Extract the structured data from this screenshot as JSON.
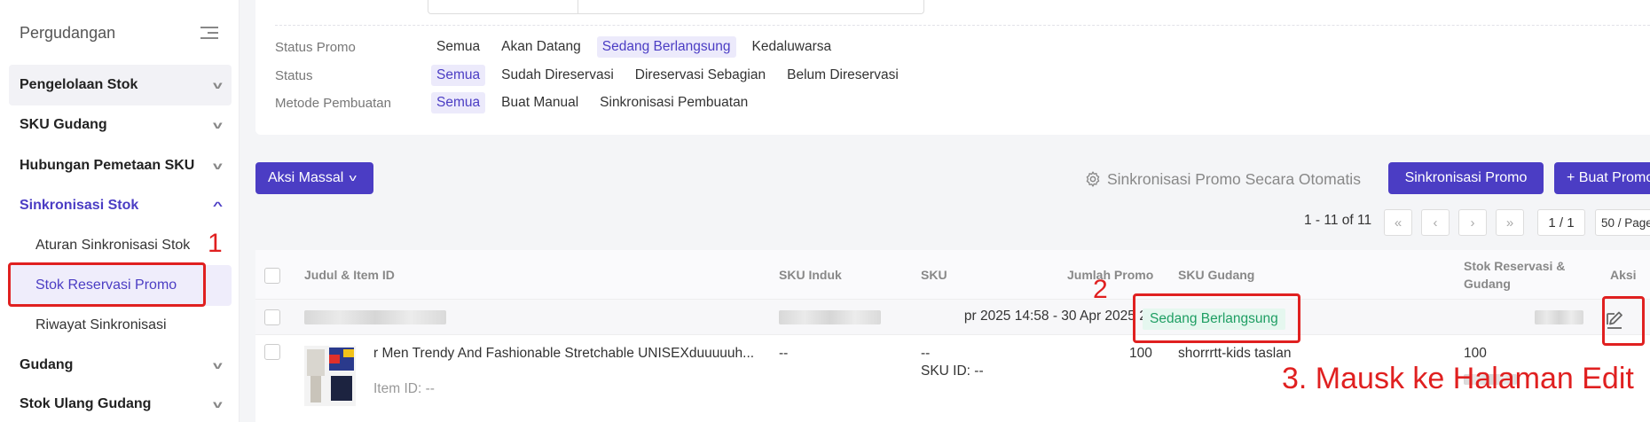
{
  "sidebar": {
    "title": "Pergudangan",
    "items": [
      {
        "label": "Pengelolaan Stok"
      },
      {
        "label": "SKU Gudang"
      },
      {
        "label": "Hubungan Pemetaan SKU"
      },
      {
        "label": "Sinkronisasi Stok"
      },
      {
        "label": "Gudang"
      },
      {
        "label": "Stok Ulang Gudang"
      }
    ],
    "subitems": [
      {
        "label": "Aturan Sinkronisasi Stok"
      },
      {
        "label": "Stok Reservasi Promo"
      },
      {
        "label": "Riwayat Sinkronisasi"
      }
    ]
  },
  "filters": {
    "promo_status": {
      "label": "Status Promo",
      "options": [
        "Semua",
        "Akan Datang",
        "Sedang Berlangsung",
        "Kedaluwarsa"
      ]
    },
    "status": {
      "label": "Status",
      "options": [
        "Semua",
        "Sudah Direservasi",
        "Direservasi Sebagian",
        "Belum Direservasi"
      ]
    },
    "method": {
      "label": "Metode Pembuatan",
      "options": [
        "Semua",
        "Buat Manual",
        "Sinkronisasi Pembuatan"
      ]
    }
  },
  "actions": {
    "bulk": "Aksi Massal",
    "auto_sync": "Sinkronisasi Promo Secara Otomatis",
    "sync": "Sinkronisasi Promo",
    "create": "+ Buat Promo"
  },
  "pagination": {
    "info": "1 - 11 of 11",
    "page": "1 / 1",
    "page_size": "50 / Page"
  },
  "table": {
    "headers": {
      "title": "Judul & Item ID",
      "parent_sku": "SKU Induk",
      "sku": "SKU",
      "promo_qty": "Jumlah Promo",
      "warehouse_sku": "SKU Gudang",
      "reserved": "Stok Reservasi & Gudang",
      "action": "Aksi"
    },
    "row1": {
      "period": "pr 2025 14:58 - 30 Apr 2025 20:00",
      "status": "Sedang Berlangsung"
    },
    "row2": {
      "title": "r Men Trendy And Fashionable Stretchable UNISEXduuuuuh...",
      "item_id": "Item ID: --",
      "parent_sku": "--",
      "sku": "--",
      "sku_id": "SKU ID: --",
      "promo_qty": "100",
      "warehouse_sku": "shorrrtt-kids taslan",
      "reserved": "100"
    }
  },
  "annotations": {
    "step1": "1",
    "step2": "2",
    "step3": "3. Mausk ke Halaman Edit",
    "color": "#e02020"
  },
  "colors": {
    "accent": "#4b3dc4",
    "status_green": "#1e9e63"
  }
}
